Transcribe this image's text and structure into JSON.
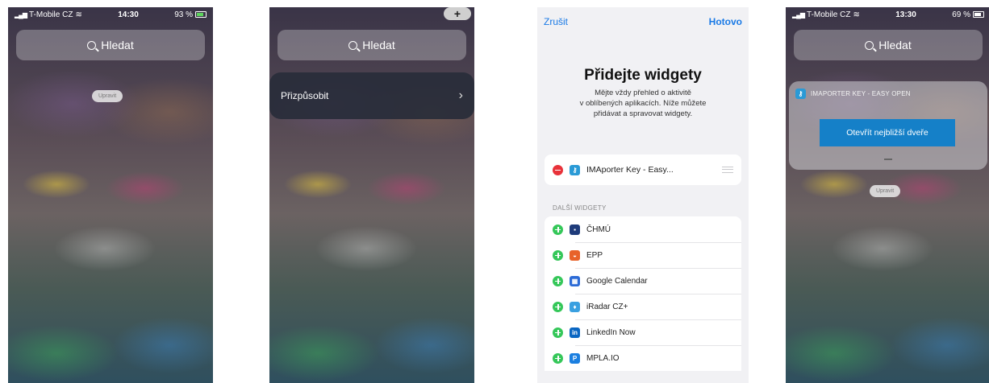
{
  "colors": {
    "accent": "#1a7ae6",
    "remove": "#e8323a",
    "add": "#35c759",
    "widget_button": "#1580c8"
  },
  "panel1": {
    "status": {
      "carrier": "T-Mobile CZ",
      "time": "14:30",
      "battery": "93 %"
    },
    "search": {
      "placeholder": "Hledat",
      "icon": "search-icon"
    },
    "edit_button": "Upravit"
  },
  "panel2": {
    "add_button": "+",
    "search": {
      "placeholder": "Hledat"
    },
    "customize": {
      "label": "Přizpůsobit",
      "chevron": "›"
    }
  },
  "panel3": {
    "cancel": "Zrušit",
    "done": "Hotovo",
    "title": "Přidejte widgety",
    "description": "Mějte vždy přehled o aktivitě\nv oblíbených aplikacích. Níže můžete\npřidávat a spravovat widgety.",
    "active_widget": {
      "label": "IMAporter Key - Easy...",
      "icon": "imaporter-icon"
    },
    "section_label": "DALŠÍ WIDGETY",
    "more_widgets": [
      {
        "label": "ČHMÚ",
        "icon": "chmu-icon",
        "color": "#1e3b7a",
        "glyph": "▪"
      },
      {
        "label": "EPP",
        "icon": "epp-icon",
        "color": "#e8622a",
        "glyph": "◒"
      },
      {
        "label": "Google Calendar",
        "icon": "google-calendar-icon",
        "color": "#2c6bd6",
        "glyph": "▦"
      },
      {
        "label": "iRadar CZ+",
        "icon": "iradar-icon",
        "color": "#3aa0e0",
        "glyph": "♦"
      },
      {
        "label": "LinkedIn Now",
        "icon": "linkedin-icon",
        "color": "#0a66c2",
        "glyph": "in"
      },
      {
        "label": "MPLA.IO",
        "icon": "mpla-icon",
        "color": "#1b7fe0",
        "glyph": "P"
      }
    ]
  },
  "panel4": {
    "status": {
      "carrier": "T-Mobile CZ",
      "time": "13:30",
      "battery": "69 %"
    },
    "search": {
      "placeholder": "Hledat"
    },
    "widget": {
      "title": "IMAPORTER KEY - EASY OPEN",
      "button": "Otevřít nejbližší dveře"
    },
    "edit_button": "Upravit"
  }
}
